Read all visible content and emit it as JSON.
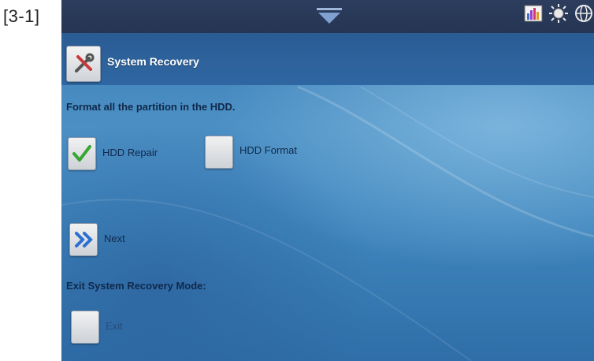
{
  "figure_label": "[3-1]",
  "title": "System Recovery",
  "instruction": "Format all the partition in the HDD.",
  "options": [
    {
      "label": "HDD Repair",
      "checked": true
    },
    {
      "label": "HDD Format",
      "checked": false
    }
  ],
  "next_label": "Next",
  "exit_section_label": "Exit System Recovery Mode:",
  "exit_label": "Exit",
  "status_icons": [
    "bar-chart-icon",
    "brightness-icon",
    "globe-icon"
  ],
  "colors": {
    "statusbar": "#2c3d5e",
    "titlebar": "#2f67a2",
    "text_dark": "#10294a",
    "check_green": "#3aa635",
    "next_blue": "#2a6fd1"
  }
}
